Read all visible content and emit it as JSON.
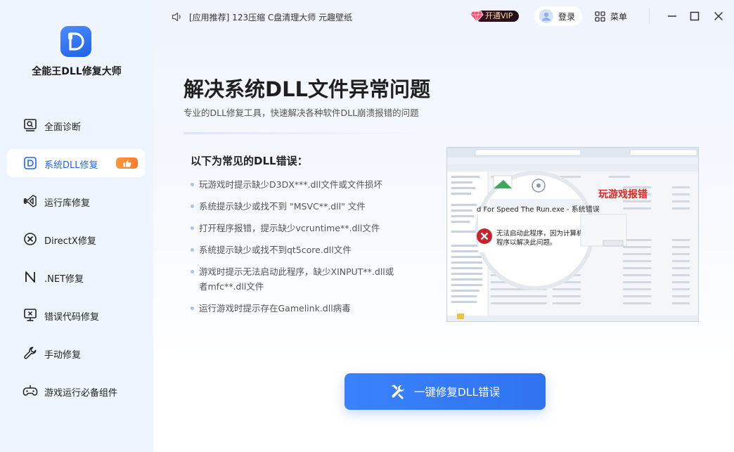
{
  "app": {
    "name": "全能王DLL修复大师"
  },
  "sidebar": {
    "items": [
      {
        "label": "全面诊断",
        "icon": "monitor-search-icon"
      },
      {
        "label": "系统DLL修复",
        "icon": "dll-d-icon",
        "active": true,
        "badge_icon": "thumbs-up-icon"
      },
      {
        "label": "运行库修复",
        "icon": "visual-studio-icon"
      },
      {
        "label": "DirectX修复",
        "icon": "directx-icon"
      },
      {
        "label": ".NET修复",
        "icon": "dotnet-n-icon"
      },
      {
        "label": "错误代码修复",
        "icon": "monitor-x-icon"
      },
      {
        "label": "手动修复",
        "icon": "wrench-icon"
      },
      {
        "label": "游戏运行必备组件",
        "icon": "gamepad-icon"
      }
    ]
  },
  "topbar": {
    "notice": "[应用推荐] 123压缩 C盘清理大师 元趣壁纸",
    "vip_label": "开通VIP",
    "login_label": "登录",
    "menu_label": "菜单"
  },
  "main": {
    "title": "解决系统DLL文件异常问题",
    "subtitle": "专业的DLL修复工具，快速解决各种软件DLL崩溃报错的问题",
    "errors_title": "以下为常见的DLL错误：",
    "errors": [
      "玩游戏时提示缺少D3DX***.dll文件或文件损坏",
      "系统提示缺少或找不到 \"MSVC**.dll\" 文件",
      "打开程序报错，提示缺少vcruntime**.dll文件",
      "系统提示缺少或找不到qt5core.dll文件",
      "游戏时提示无法启动此程序，缺少XINPUT**.dll或者mfc**.dll文件",
      "运行游戏时提示存在Gamelink.dll病毒"
    ],
    "screenshot": {
      "red_label": "玩游戏报错",
      "dialog_title": "d For Speed The Run.exe - 系统错误",
      "dialog_text_1": "无法启动此程序，因为计算机中丢",
      "dialog_text_2": "程序以解决此问题。"
    },
    "fix_button_label": "一键修复DLL错误"
  },
  "colors": {
    "accent": "#2f73f1",
    "sidebar_bg": "#eef5fe",
    "badge": "#ff8a33",
    "error_red": "#e0261e"
  }
}
